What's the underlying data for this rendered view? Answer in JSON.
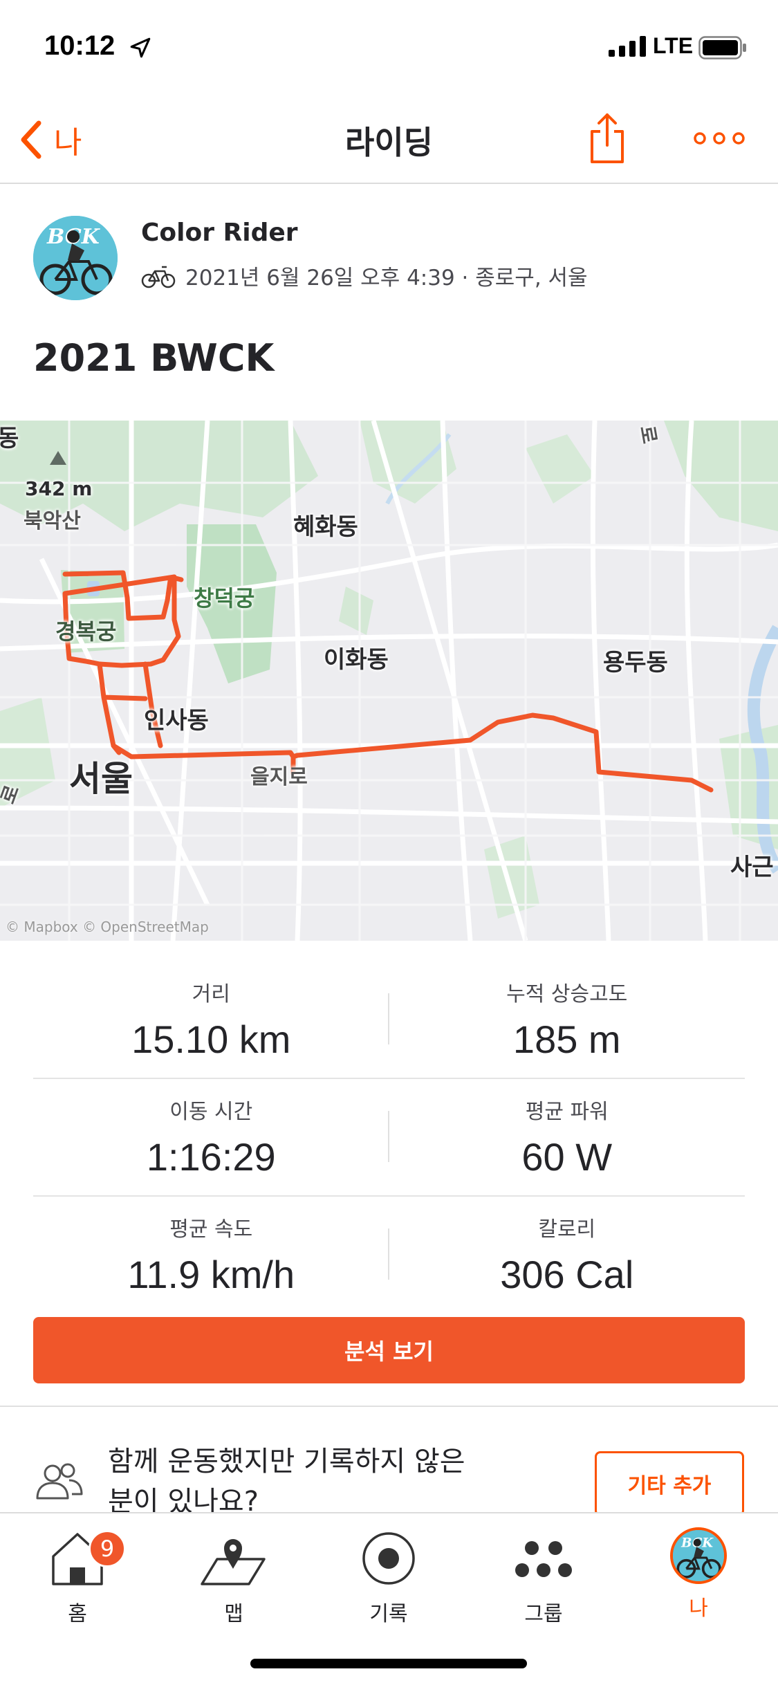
{
  "status_bar": {
    "time": "10:12",
    "network": "LTE"
  },
  "nav": {
    "back_label": "나",
    "title": "라이딩"
  },
  "athlete": {
    "name": "Color Rider",
    "meta": "2021년 6월 26일 오후 4:39 · 종로구, 서울"
  },
  "activity": {
    "title": "2021 BWCK"
  },
  "map": {
    "labels": {
      "dong_edge": "동",
      "elevation": "342 m",
      "bugaksan": "북악산",
      "hyehwa": "혜화동",
      "changdeok": "창덕궁",
      "gyeongbok": "경복궁",
      "ihwa": "이화동",
      "yongdu": "용두동",
      "insa": "인사동",
      "seoul": "서울",
      "euljiro": "을지로",
      "sagun": "사근",
      "road_top": "로",
      "road_left": "로"
    },
    "attribution": "© Mapbox © OpenStreetMap",
    "route_color": "#f0562a"
  },
  "stats": [
    {
      "left": {
        "label": "거리",
        "value": "15.10 km"
      },
      "right": {
        "label": "누적 상승고도",
        "value": "185 m"
      }
    },
    {
      "left": {
        "label": "이동 시간",
        "value": "1:16:29"
      },
      "right": {
        "label": "평균 파워",
        "value": "60 W"
      }
    },
    {
      "left": {
        "label": "평균 속도",
        "value": "11.9 km/h"
      },
      "right": {
        "label": "칼로리",
        "value": "306 Cal"
      }
    }
  ],
  "analysis_button": "분석 보기",
  "add_others": {
    "prompt": "함께 운동했지만 기록하지 않은 분이 있나요?",
    "button": "기타 추가"
  },
  "tab_bar": {
    "home": {
      "label": "홈",
      "badge": "9"
    },
    "maps": {
      "label": "맵"
    },
    "record": {
      "label": "기록"
    },
    "groups": {
      "label": "그룹"
    },
    "you": {
      "label": "나"
    }
  },
  "colors": {
    "accent": "#fc5200",
    "button": "#f0562a"
  }
}
